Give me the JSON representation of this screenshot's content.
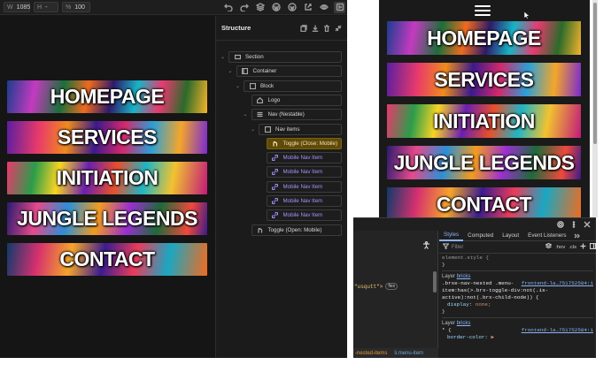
{
  "toolbar": {
    "width_value": "1085",
    "h_label": "H",
    "h_value": "-",
    "percent_label": "%",
    "zoom_value": "100",
    "icons": [
      "undo-icon",
      "redo-icon",
      "layers-icon",
      "wordpress-icon",
      "wordpress-admin-icon",
      "external-link-icon",
      "preview-eye-icon",
      "structure-panel-icon"
    ]
  },
  "canvas": {
    "nav_items": [
      "HOMEPAGE",
      "SERVICES",
      "INITIATION",
      "JUNGLE LEGENDS",
      "CONTACT"
    ]
  },
  "structure": {
    "title": "Structure",
    "header_icons": [
      "copy-icon",
      "download-icon",
      "trash-icon",
      "collapse-icon"
    ],
    "tree": [
      {
        "label": "Section",
        "icon": "section-icon",
        "level": 0,
        "chevron": true,
        "style": "normal"
      },
      {
        "label": "Container",
        "icon": "container-icon",
        "level": 1,
        "chevron": true,
        "style": "normal"
      },
      {
        "label": "Block",
        "icon": "block-icon",
        "level": 2,
        "chevron": true,
        "style": "normal"
      },
      {
        "label": "Logo",
        "icon": "logo-icon",
        "level": 3,
        "chevron": false,
        "style": "normal"
      },
      {
        "label": "Nav (Nestable)",
        "icon": "nav-icon",
        "level": 3,
        "chevron": true,
        "style": "normal"
      },
      {
        "label": "Nav items",
        "icon": "block-icon",
        "level": 4,
        "chevron": true,
        "style": "normal"
      },
      {
        "label": "Toggle (Close: Mobile)",
        "icon": "toggle-icon",
        "level": 5,
        "chevron": false,
        "style": "selected"
      },
      {
        "label": "Mobile Nav Item",
        "icon": "link-icon",
        "level": 5,
        "chevron": false,
        "style": "purple"
      },
      {
        "label": "Mobile Nav Item",
        "icon": "link-icon",
        "level": 5,
        "chevron": false,
        "style": "purple"
      },
      {
        "label": "Mobile Nav Item",
        "icon": "link-icon",
        "level": 5,
        "chevron": false,
        "style": "purple"
      },
      {
        "label": "Mobile Nav Item",
        "icon": "link-icon",
        "level": 5,
        "chevron": false,
        "style": "purple"
      },
      {
        "label": "Mobile Nav Item",
        "icon": "link-icon",
        "level": 5,
        "chevron": false,
        "style": "purple"
      },
      {
        "label": "Toggle (Open: Mobile)",
        "icon": "toggle-icon",
        "level": 3,
        "chevron": false,
        "style": "normal"
      }
    ]
  },
  "preview": {
    "nav_items": [
      "HOMEPAGE",
      "SERVICES",
      "INITIATION",
      "JUNGLE LEGENDS",
      "CONTACT"
    ],
    "menu_icon": "hamburger-icon"
  },
  "devtools": {
    "element_snippet": "\"usqutt\">",
    "flex_badge": "flex",
    "breadcrumbs": [
      "-nested-items",
      "li.menu-item"
    ],
    "tabs": [
      "Styles",
      "Computed",
      "Layout",
      "Event Listeners"
    ],
    "active_tab": "Styles",
    "filter_placeholder": "Filter",
    "hov": ":hov",
    "cls": ".cls",
    "rules": {
      "element_style": "element.style {",
      "element_close": "}",
      "layer1_label": "Layer",
      "layer1_link": "bricks",
      "rule1_selector": ".brxe-nav-nested .menu-item:has(>.brx-toggle-div:not(.is-active):not(.brx-child-node)) {",
      "rule1_source": "frontend-la…751752584:1",
      "rule1_prop": "display",
      "rule1_value": "none;",
      "rule1_close": "}",
      "layer2_label": "Layer",
      "layer2_link": "bricks",
      "rule2_selector": "* {",
      "rule2_source": "frontend-la…751752584:1",
      "rule2_prop": "border-color",
      "rule2_value": "▶"
    }
  },
  "colors": {
    "builder_bg": "#161616",
    "selected_node": "#5f4a0a",
    "purple_node": "#a891ff",
    "devtools_link": "#8ab4f8"
  }
}
